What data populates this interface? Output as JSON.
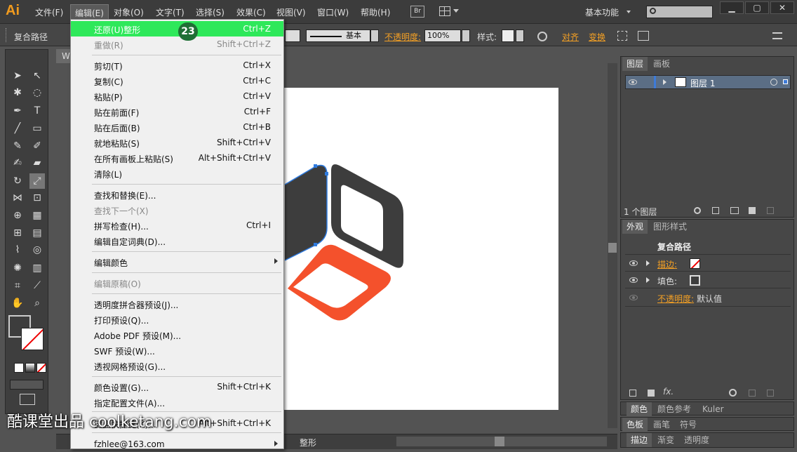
{
  "app": {
    "logo": "Ai",
    "workspace": "基本功能",
    "br": "Br"
  },
  "menu": [
    "文件(F)",
    "编辑(E)",
    "对象(O)",
    "文字(T)",
    "选择(S)",
    "效果(C)",
    "视图(V)",
    "窗口(W)",
    "帮助(H)"
  ],
  "control": {
    "object": "复合路径",
    "stroke_style": "基本",
    "opacity_label": "不透明度:",
    "opacity_value": "100%",
    "style_label": "样式:",
    "align": "对齐",
    "transform": "变换"
  },
  "doc_tab": "W",
  "edit_menu": {
    "items": [
      {
        "label": "还原(U)整形",
        "shortcut": "Ctrl+Z",
        "state": "highlight"
      },
      {
        "label": "重做(R)",
        "shortcut": "Shift+Ctrl+Z",
        "state": "disabled"
      },
      {
        "label": "剪切(T)",
        "shortcut": "Ctrl+X",
        "state": "normal"
      },
      {
        "label": "复制(C)",
        "shortcut": "Ctrl+C",
        "state": "normal"
      },
      {
        "label": "粘贴(P)",
        "shortcut": "Ctrl+V",
        "state": "normal"
      },
      {
        "label": "贴在前面(F)",
        "shortcut": "Ctrl+F",
        "state": "normal"
      },
      {
        "label": "贴在后面(B)",
        "shortcut": "Ctrl+B",
        "state": "normal"
      },
      {
        "label": "就地粘贴(S)",
        "shortcut": "Shift+Ctrl+V",
        "state": "normal"
      },
      {
        "label": "在所有画板上粘贴(S)",
        "shortcut": "Alt+Shift+Ctrl+V",
        "state": "normal"
      },
      {
        "label": "清除(L)",
        "shortcut": "",
        "state": "normal"
      },
      {
        "label": "查找和替换(E)...",
        "shortcut": "",
        "state": "normal"
      },
      {
        "label": "查找下一个(X)",
        "shortcut": "",
        "state": "disabled"
      },
      {
        "label": "拼写检查(H)...",
        "shortcut": "Ctrl+I",
        "state": "normal"
      },
      {
        "label": "编辑自定词典(D)...",
        "shortcut": "",
        "state": "normal"
      },
      {
        "label": "编辑颜色",
        "shortcut": "",
        "state": "submenu"
      },
      {
        "label": "编辑原稿(O)",
        "shortcut": "",
        "state": "disabled"
      },
      {
        "label": "透明度拼合器预设(J)...",
        "shortcut": "",
        "state": "normal"
      },
      {
        "label": "打印预设(Q)...",
        "shortcut": "",
        "state": "normal"
      },
      {
        "label": "Adobe PDF 预设(M)...",
        "shortcut": "",
        "state": "normal"
      },
      {
        "label": "SWF 预设(W)...",
        "shortcut": "",
        "state": "normal"
      },
      {
        "label": "透视网格预设(G)...",
        "shortcut": "",
        "state": "normal"
      },
      {
        "label": "颜色设置(G)...",
        "shortcut": "Shift+Ctrl+K",
        "state": "normal"
      },
      {
        "label": "指定配置文件(A)...",
        "shortcut": "",
        "state": "normal"
      },
      {
        "label": "键盘快捷键(K)...",
        "shortcut": "Alt+Shift+Ctrl+K",
        "state": "normal"
      },
      {
        "label": "fzhlee@163.com",
        "shortcut": "",
        "state": "submenu"
      }
    ],
    "badge": "23"
  },
  "layers_panel": {
    "tabs": [
      "图层",
      "画板"
    ],
    "layer_name": "图层 1",
    "count": "1 个图层"
  },
  "appearance_panel": {
    "tabs": [
      "外观",
      "图形样式"
    ],
    "title": "复合路径",
    "stroke": "描边:",
    "fill": "填色:",
    "opacity": "不透明度:",
    "opacity_value": "默认值"
  },
  "color_panel": {
    "tabs": [
      "颜色",
      "颜色参考",
      "Kuler"
    ]
  },
  "swatch_panel": {
    "tabs": [
      "色板",
      "画笔",
      "符号"
    ]
  },
  "stroke_panel": {
    "tabs": [
      "描边",
      "渐变",
      "透明度"
    ]
  },
  "status": {
    "tool": "整形"
  },
  "watermark": "酷课堂出品 coolketang.com",
  "colors": {
    "highlight": "#2ee85a",
    "shape_dark": "#3d3d3d",
    "shape_orange": "#f4512c",
    "accent": "#f4a024"
  }
}
